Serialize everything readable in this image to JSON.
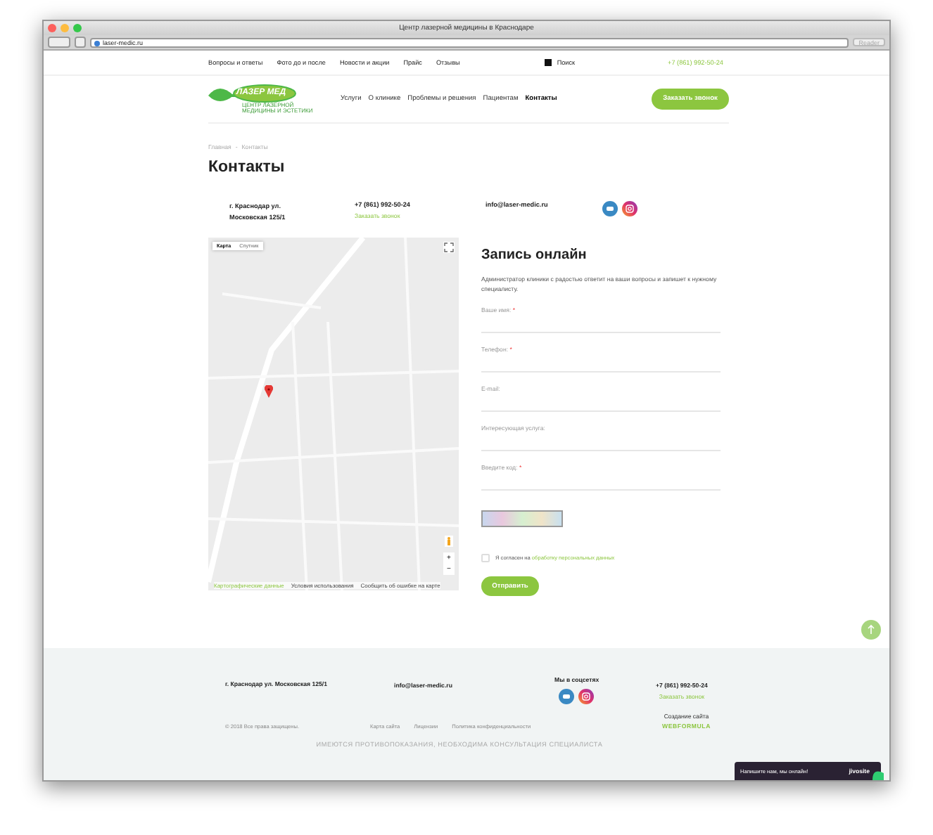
{
  "browser": {
    "title": "Центр лазерной медицины в Краснодаре",
    "url": "laser-medic.ru",
    "reader_button": "Reader"
  },
  "top_nav": {
    "links": [
      "Вопросы и ответы",
      "Фото до и после",
      "Новости и акции",
      "Прайс",
      "Отзывы"
    ],
    "search": "Поиск",
    "phone": "+7 (861) 992-50-24"
  },
  "header": {
    "logo": {
      "name": "ЛАЗЕР МЕД",
      "tagline": [
        "ЦЕНТР ЛАЗЕРНОЙ",
        "МЕДИЦИНЫ И ЭСТЕТИКИ"
      ]
    },
    "nav": [
      {
        "label": "Услуги",
        "selected": false
      },
      {
        "label": "О клинике",
        "selected": false
      },
      {
        "label": "Проблемы и решения",
        "selected": false
      },
      {
        "label": "Пациентам",
        "selected": false
      },
      {
        "label": "Контакты",
        "selected": true
      }
    ],
    "callback_button": "Заказать звонок"
  },
  "breadcrumb": [
    "Главная",
    "Контакты"
  ],
  "breadcrumb_separator": "-",
  "page_title": "Контакты",
  "contacts": {
    "address_lines": [
      "г. Краснодар ул.",
      "Московская 125/1"
    ],
    "phone": "+7 (861) 992-50-24",
    "callback_link": "Заказать звонок",
    "email": "info@laser-medic.ru"
  },
  "map": {
    "tabs": [
      {
        "label": "Карта",
        "selected": true
      },
      {
        "label": "Спутник",
        "selected": false
      }
    ],
    "zoom_in": "+",
    "zoom_out": "−",
    "attribution": [
      "Картографические данные",
      "Условия использования",
      "Сообщить об ошибке на карте"
    ]
  },
  "form": {
    "title": "Запись онлайн",
    "description": "Администратор клиники с радостью ответит на ваши вопросы и запишет к нужному специалисту.",
    "fields": [
      {
        "label": "Ваше имя:",
        "required_mark": "*"
      },
      {
        "label": "Телефон:",
        "required_mark": "*"
      },
      {
        "label": "E-mail:"
      },
      {
        "label": "Интересующая услуга:"
      },
      {
        "label": "Введите код:",
        "required_mark": "*"
      }
    ],
    "consent": {
      "checked": false,
      "text": "Я согласен на",
      "link": "обработку персональных данных"
    },
    "submit": "Отправить"
  },
  "footer": {
    "address": "г. Краснодар ул. Московская 125/1",
    "email": "info@laser-medic.ru",
    "social_title": "Мы в соцсетях",
    "phone": "+7 (861) 992-50-24",
    "callback_link": "Заказать звонок",
    "copyright": "© 2018 Все права защищены.",
    "links": [
      "Карта сайта",
      "Лицензии",
      "Политика конфиденциальности"
    ],
    "credit": "Создание сайта",
    "credit_brand": "WEBFORMULA",
    "disclaimer": "ИМЕЮТСЯ ПРОТИВОПОКАЗАНИЯ, НЕОБХОДИМА КОНСУЛЬТАЦИЯ СПЕЦИАЛИСТА"
  },
  "chat": {
    "text": "Напишите нам, мы онлайн!",
    "brand": "jivosite"
  }
}
